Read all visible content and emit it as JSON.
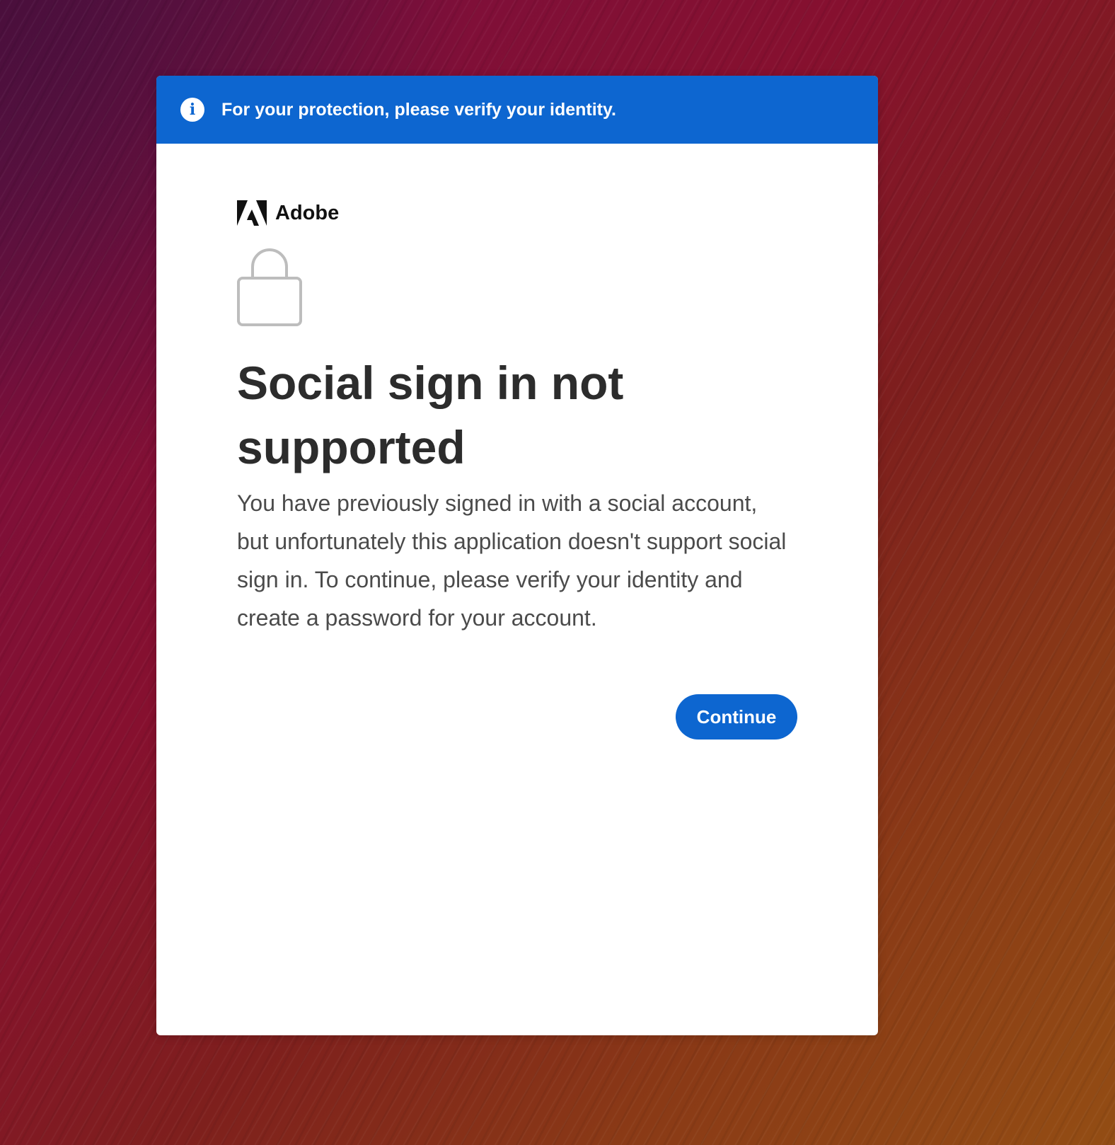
{
  "banner": {
    "icon": "info-icon",
    "message": "For your protection, please verify your identity."
  },
  "brand": {
    "logo": "adobe-logo-icon",
    "name": "Adobe"
  },
  "illustration": {
    "icon": "lock-icon"
  },
  "main": {
    "title": "Social sign in not supported",
    "body": "You have previously signed in with a social account, but unfortunately this application doesn't support social sign in. To continue, please verify your identity and create a password for your account.",
    "continue_label": "Continue"
  },
  "colors": {
    "accent": "#0d66d0",
    "title": "#2c2c2c",
    "body": "#4b4b4b",
    "lock_stroke": "#bdbdbd"
  }
}
